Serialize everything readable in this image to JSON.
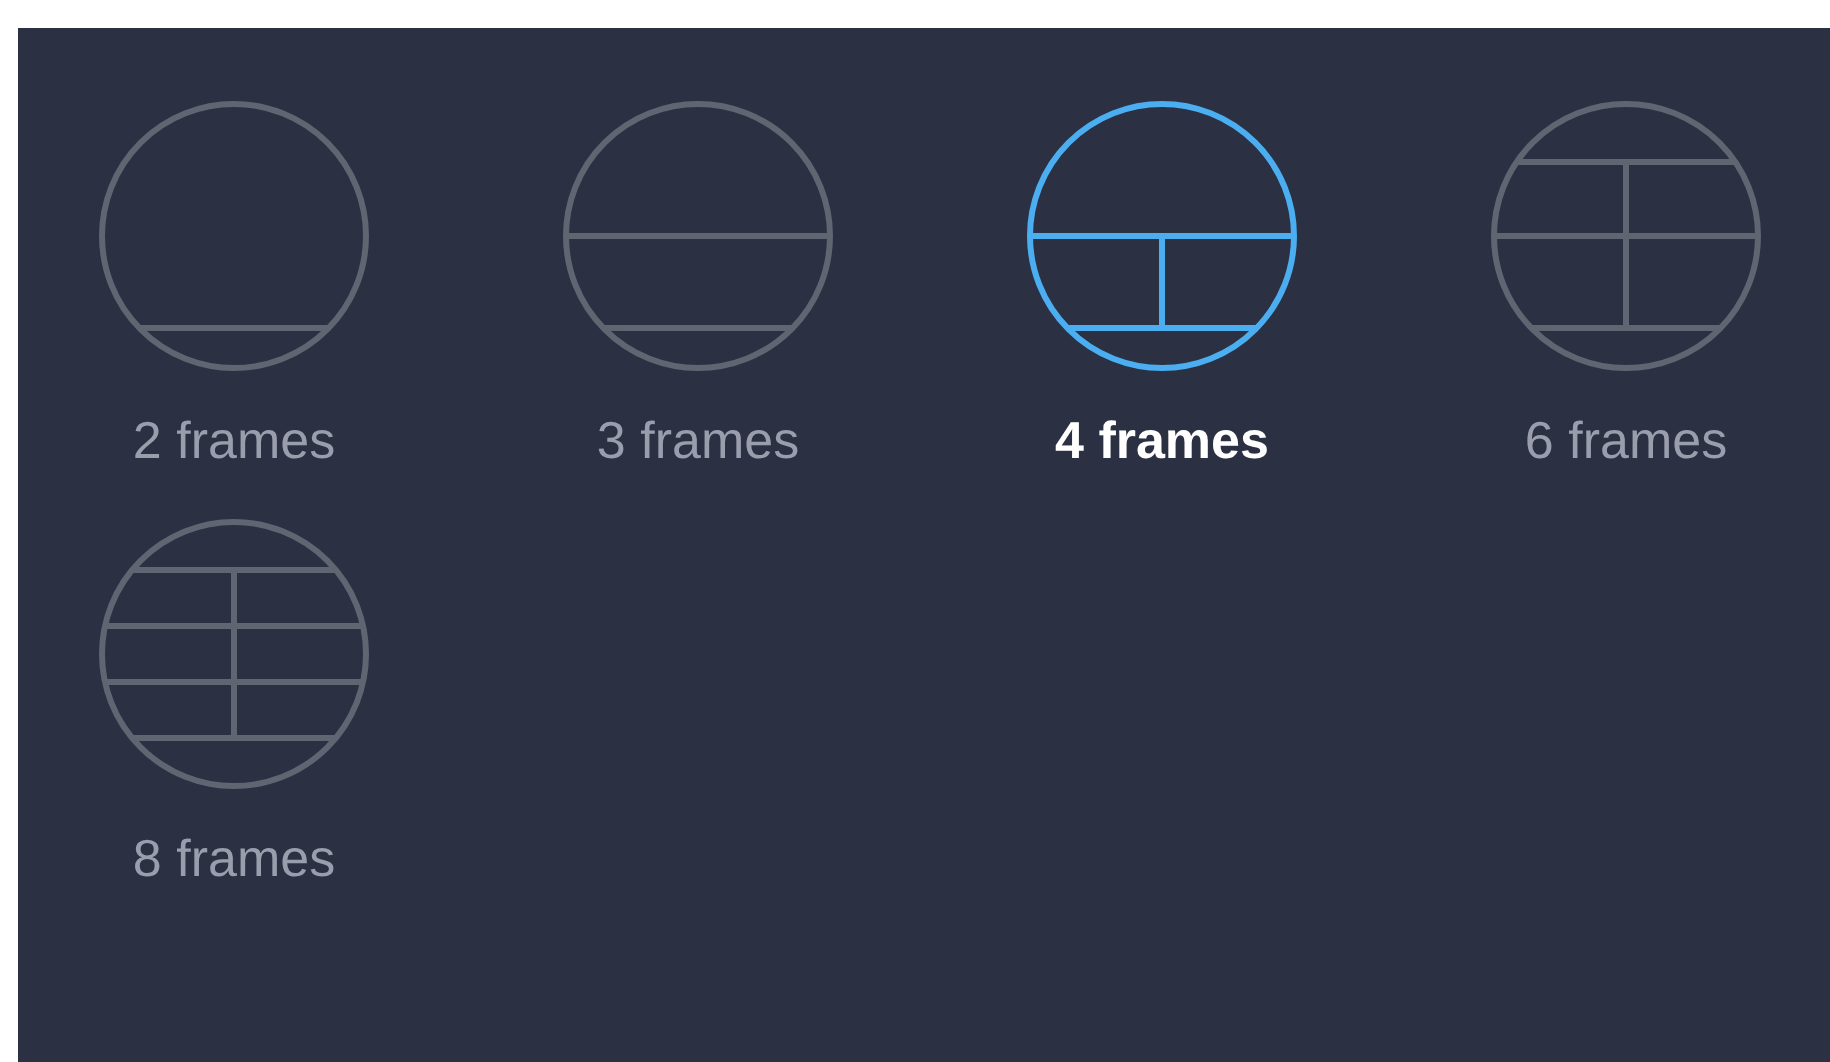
{
  "layout_options": [
    {
      "kind": "two",
      "label": "2 frames",
      "selected": false
    },
    {
      "kind": "three",
      "label": "3 frames",
      "selected": false
    },
    {
      "kind": "four",
      "label": "4 frames",
      "selected": true
    },
    {
      "kind": "six",
      "label": "6 frames",
      "selected": false
    },
    {
      "kind": "eight",
      "label": "8 frames",
      "selected": false
    }
  ]
}
